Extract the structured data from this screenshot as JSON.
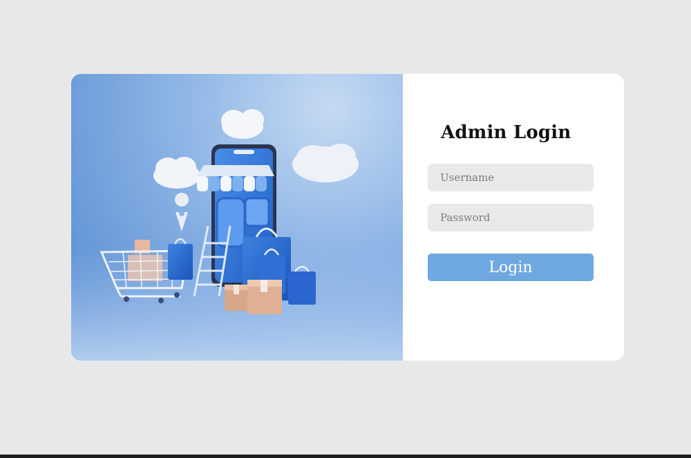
{
  "login_form": {
    "title": "Admin Login",
    "username_placeholder": "Username",
    "password_placeholder": "Password",
    "submit_label": "Login"
  },
  "colors": {
    "page_background": "#e8e8e8",
    "card_background": "#ffffff",
    "input_background": "#e9e9e9",
    "button_accent": "#6fa8e0",
    "hero_blue": "#4f86cf"
  },
  "hero_illustration": {
    "icons": [
      "cloud-icon",
      "smartphone-storefront-icon",
      "awning-icon",
      "shopping-cart-icon",
      "shopping-bag-icon",
      "location-pin-icon",
      "package-box-icon",
      "ladder-icon"
    ]
  }
}
